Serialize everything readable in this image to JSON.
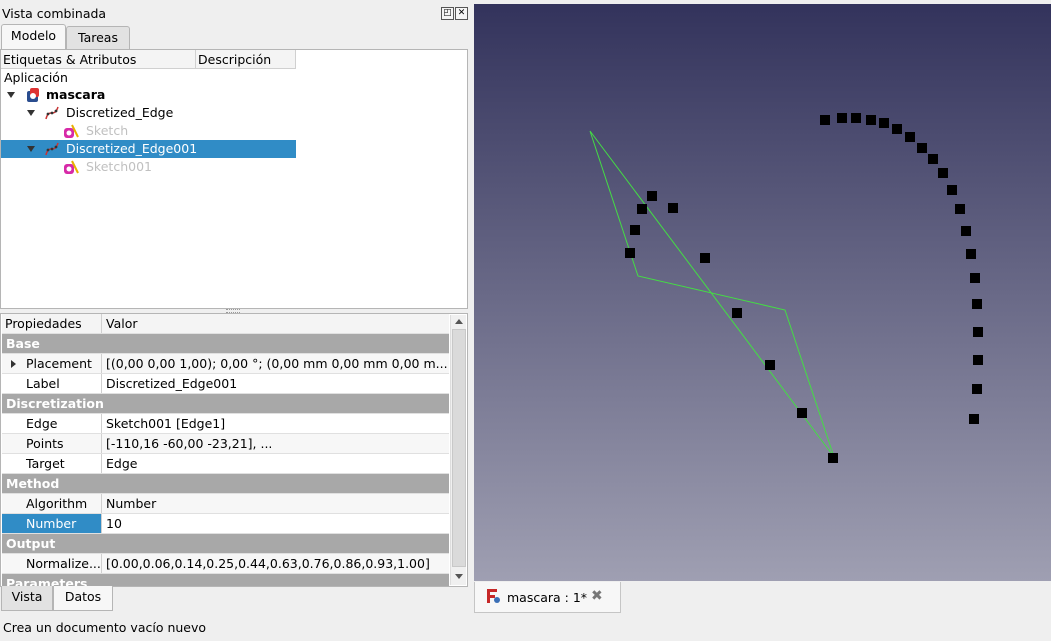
{
  "combo_view": {
    "title": "Vista combinada",
    "tabs": [
      "Modelo",
      "Tareas"
    ],
    "bottom_tabs": [
      "Vista",
      "Datos"
    ]
  },
  "tree": {
    "headers": [
      "Etiquetas & Atributos",
      "Descripción"
    ],
    "section": "Aplicación",
    "items": [
      {
        "label": "mascara",
        "level": 0
      },
      {
        "label": "Discretized_Edge",
        "level": 1
      },
      {
        "label": "Sketch",
        "level": 2
      },
      {
        "label": "Discretized_Edge001",
        "level": 1,
        "selected": true
      },
      {
        "label": "Sketch001",
        "level": 2
      }
    ]
  },
  "properties": {
    "headers": [
      "Propiedades",
      "Valor"
    ],
    "groups": [
      {
        "name": "Base",
        "rows": [
          {
            "name": "Placement",
            "value": "[(0,00 0,00 1,00); 0,00 °; (0,00 mm  0,00 mm  0,00 m..."
          },
          {
            "name": "Label",
            "value": "Discretized_Edge001"
          }
        ]
      },
      {
        "name": "Discretization",
        "rows": [
          {
            "name": "Edge",
            "value": "Sketch001 [Edge1]"
          },
          {
            "name": "Points",
            "value": "[-110,16 -60,00 -23,21], ..."
          },
          {
            "name": "Target",
            "value": "Edge"
          }
        ]
      },
      {
        "name": "Method",
        "rows": [
          {
            "name": "Algorithm",
            "value": "Number"
          },
          {
            "name": "Number",
            "value": "10"
          }
        ]
      },
      {
        "name": "Output",
        "rows": [
          {
            "name": "Normalize...",
            "value": "[0.00,0.06,0.14,0.25,0.44,0.63,0.76,0.86,0.93,1.00]"
          }
        ]
      },
      {
        "name": "Parameters",
        "rows": []
      }
    ]
  },
  "document_tab": {
    "label": "mascara : 1*"
  },
  "status_bar": {
    "text": "Crea un documento vacío nuevo"
  },
  "colors": {
    "selection": "#308cc6",
    "sketch_line": "#44dd44",
    "group_header": "#a8a8a8"
  }
}
